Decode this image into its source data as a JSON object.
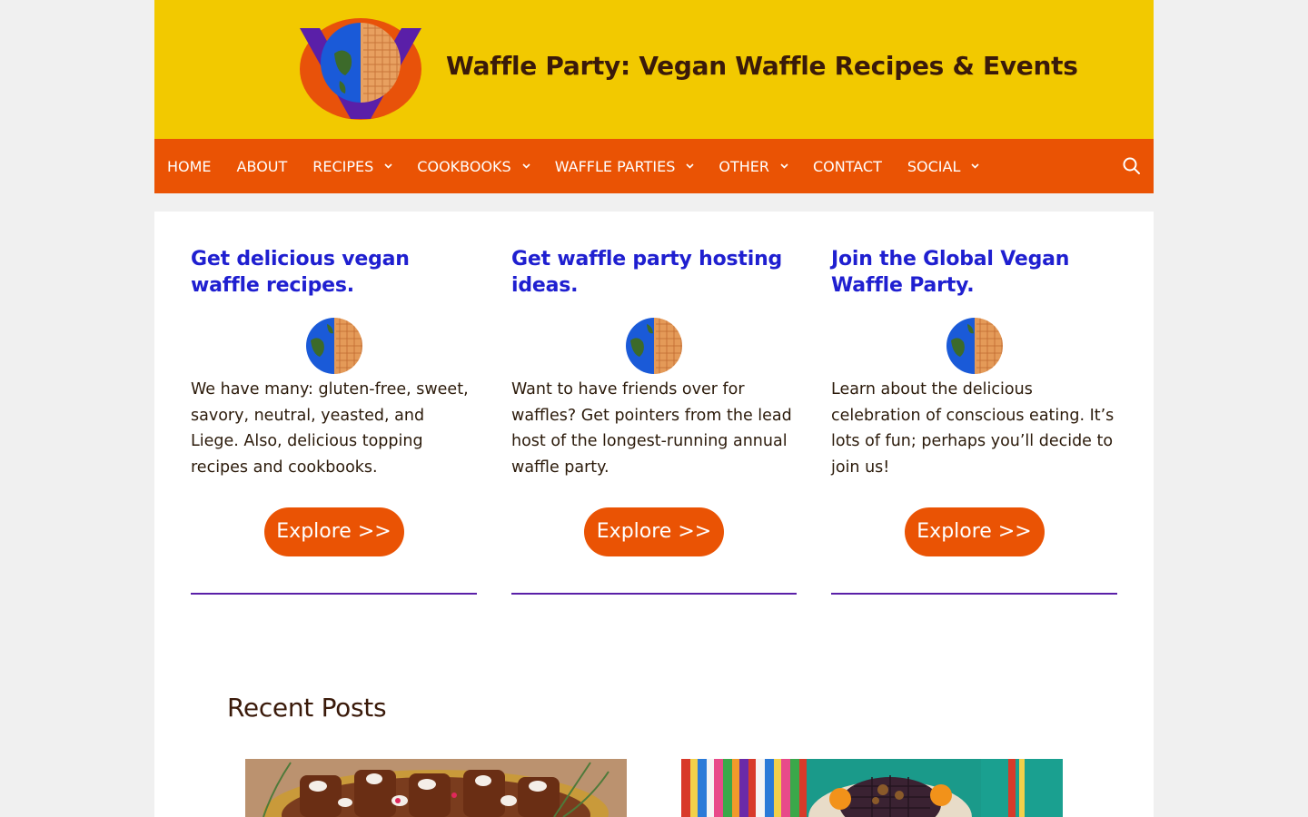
{
  "header": {
    "site_title": "Waffle Party: Vegan Waffle Recipes & Events"
  },
  "nav": {
    "items": [
      {
        "label": "HOME",
        "has_dropdown": false
      },
      {
        "label": "ABOUT",
        "has_dropdown": false
      },
      {
        "label": "RECIPES",
        "has_dropdown": true
      },
      {
        "label": "COOKBOOKS",
        "has_dropdown": true
      },
      {
        "label": "WAFFLE PARTIES",
        "has_dropdown": true
      },
      {
        "label": "OTHER",
        "has_dropdown": true
      },
      {
        "label": "CONTACT",
        "has_dropdown": false
      },
      {
        "label": "SOCIAL",
        "has_dropdown": true
      }
    ],
    "search_icon": "search-icon"
  },
  "columns": [
    {
      "heading": "Get delicious vegan waffle recipes.",
      "text": "We have many: gluten-free, sweet, savory, neutral, yeasted, and Liege. Also, delicious topping recipes and cookbooks.",
      "button": "Explore >>"
    },
    {
      "heading": "Get waffle party hosting ideas.",
      "text": "Want to have friends over for waffles? Get pointers from the lead host of the longest-running annual waffle party.",
      "button": "Explore >>"
    },
    {
      "heading": "Join the Global Vegan Waffle Party.",
      "text": "Learn about the delicious celebration of conscious eating. It’s lots of fun; perhaps you’ll decide to join us!",
      "button": "Explore >>"
    }
  ],
  "recent_posts": {
    "title": "Recent Posts"
  },
  "colors": {
    "header_bg": "#f2c900",
    "nav_bg": "#ea5304",
    "heading": "#1f1fd0",
    "divider": "#5a1fa8"
  }
}
